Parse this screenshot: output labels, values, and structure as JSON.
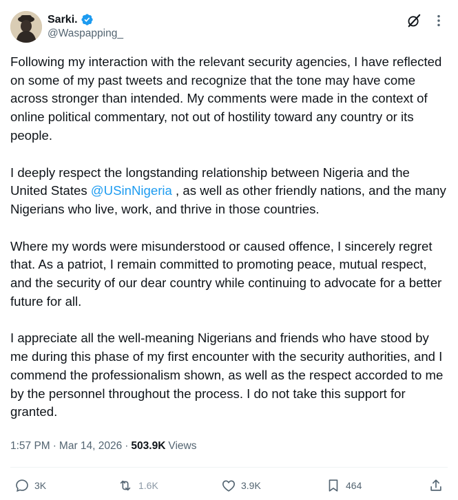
{
  "user": {
    "display_name": "Sarki.",
    "handle": "@Waspapping_",
    "verified": true
  },
  "tweet": {
    "paragraphs": [
      "Following my interaction with the relevant security agencies, I have reflected on some of my past tweets and recognize that the tone may have come across stronger than intended. My comments were made in the context of online political commentary, not out of hostility toward any country or its people.",
      "Where my words were misunderstood or caused offence, I sincerely regret that. As a patriot, I remain committed to promoting peace, mutual respect, and the security of our dear country while continuing to advocate for a better future for all.",
      "I appreciate all the well-meaning Nigerians and friends who have stood by me during this phase of my first encounter with the security authorities, and I commend the professionalism shown, as well as the respect accorded to me by the personnel throughout the process. I do not take this support for granted."
    ],
    "paragraph2": {
      "before": "I deeply respect the longstanding relationship between Nigeria and the United States ",
      "mention": "@USinNigeria",
      "after": " , as well as other friendly nations, and the many Nigerians who live, work, and thrive in those countries."
    }
  },
  "meta": {
    "time": "1:57 PM",
    "separator": "·",
    "date": "Mar 14, 2026",
    "views_count": "503.9K",
    "views_label": "Views"
  },
  "actions": {
    "replies": "3K",
    "reposts": "1.6K",
    "likes": "3.9K",
    "bookmarks": "464"
  },
  "colors": {
    "text": "#0f1419",
    "secondary": "#536471",
    "accent": "#1d9bf0",
    "divider": "#eff3f4"
  },
  "icons": {
    "header": [
      "verified-badge-icon",
      "grok-icon",
      "more-icon"
    ],
    "actions": [
      "reply-icon",
      "repost-icon",
      "like-icon",
      "bookmark-icon",
      "share-icon"
    ]
  }
}
